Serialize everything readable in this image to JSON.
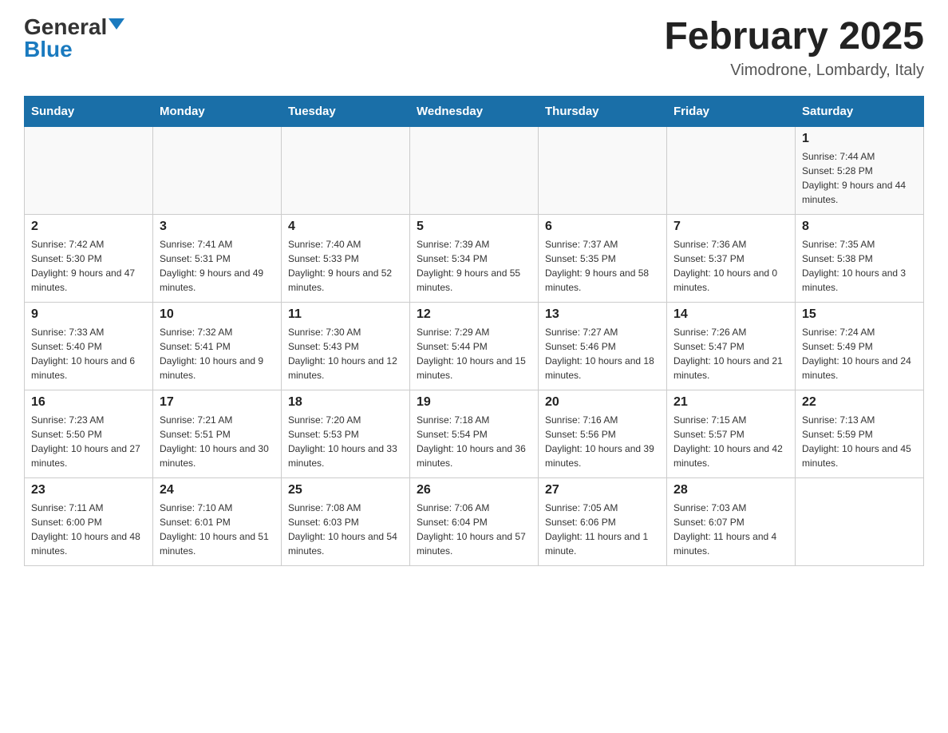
{
  "header": {
    "logo_general": "General",
    "logo_blue": "Blue",
    "title": "February 2025",
    "location": "Vimodrone, Lombardy, Italy"
  },
  "weekdays": [
    "Sunday",
    "Monday",
    "Tuesday",
    "Wednesday",
    "Thursday",
    "Friday",
    "Saturday"
  ],
  "rows": [
    [
      {
        "day": "",
        "sunrise": "",
        "sunset": "",
        "daylight": ""
      },
      {
        "day": "",
        "sunrise": "",
        "sunset": "",
        "daylight": ""
      },
      {
        "day": "",
        "sunrise": "",
        "sunset": "",
        "daylight": ""
      },
      {
        "day": "",
        "sunrise": "",
        "sunset": "",
        "daylight": ""
      },
      {
        "day": "",
        "sunrise": "",
        "sunset": "",
        "daylight": ""
      },
      {
        "day": "",
        "sunrise": "",
        "sunset": "",
        "daylight": ""
      },
      {
        "day": "1",
        "sunrise": "Sunrise: 7:44 AM",
        "sunset": "Sunset: 5:28 PM",
        "daylight": "Daylight: 9 hours and 44 minutes."
      }
    ],
    [
      {
        "day": "2",
        "sunrise": "Sunrise: 7:42 AM",
        "sunset": "Sunset: 5:30 PM",
        "daylight": "Daylight: 9 hours and 47 minutes."
      },
      {
        "day": "3",
        "sunrise": "Sunrise: 7:41 AM",
        "sunset": "Sunset: 5:31 PM",
        "daylight": "Daylight: 9 hours and 49 minutes."
      },
      {
        "day": "4",
        "sunrise": "Sunrise: 7:40 AM",
        "sunset": "Sunset: 5:33 PM",
        "daylight": "Daylight: 9 hours and 52 minutes."
      },
      {
        "day": "5",
        "sunrise": "Sunrise: 7:39 AM",
        "sunset": "Sunset: 5:34 PM",
        "daylight": "Daylight: 9 hours and 55 minutes."
      },
      {
        "day": "6",
        "sunrise": "Sunrise: 7:37 AM",
        "sunset": "Sunset: 5:35 PM",
        "daylight": "Daylight: 9 hours and 58 minutes."
      },
      {
        "day": "7",
        "sunrise": "Sunrise: 7:36 AM",
        "sunset": "Sunset: 5:37 PM",
        "daylight": "Daylight: 10 hours and 0 minutes."
      },
      {
        "day": "8",
        "sunrise": "Sunrise: 7:35 AM",
        "sunset": "Sunset: 5:38 PM",
        "daylight": "Daylight: 10 hours and 3 minutes."
      }
    ],
    [
      {
        "day": "9",
        "sunrise": "Sunrise: 7:33 AM",
        "sunset": "Sunset: 5:40 PM",
        "daylight": "Daylight: 10 hours and 6 minutes."
      },
      {
        "day": "10",
        "sunrise": "Sunrise: 7:32 AM",
        "sunset": "Sunset: 5:41 PM",
        "daylight": "Daylight: 10 hours and 9 minutes."
      },
      {
        "day": "11",
        "sunrise": "Sunrise: 7:30 AM",
        "sunset": "Sunset: 5:43 PM",
        "daylight": "Daylight: 10 hours and 12 minutes."
      },
      {
        "day": "12",
        "sunrise": "Sunrise: 7:29 AM",
        "sunset": "Sunset: 5:44 PM",
        "daylight": "Daylight: 10 hours and 15 minutes."
      },
      {
        "day": "13",
        "sunrise": "Sunrise: 7:27 AM",
        "sunset": "Sunset: 5:46 PM",
        "daylight": "Daylight: 10 hours and 18 minutes."
      },
      {
        "day": "14",
        "sunrise": "Sunrise: 7:26 AM",
        "sunset": "Sunset: 5:47 PM",
        "daylight": "Daylight: 10 hours and 21 minutes."
      },
      {
        "day": "15",
        "sunrise": "Sunrise: 7:24 AM",
        "sunset": "Sunset: 5:49 PM",
        "daylight": "Daylight: 10 hours and 24 minutes."
      }
    ],
    [
      {
        "day": "16",
        "sunrise": "Sunrise: 7:23 AM",
        "sunset": "Sunset: 5:50 PM",
        "daylight": "Daylight: 10 hours and 27 minutes."
      },
      {
        "day": "17",
        "sunrise": "Sunrise: 7:21 AM",
        "sunset": "Sunset: 5:51 PM",
        "daylight": "Daylight: 10 hours and 30 minutes."
      },
      {
        "day": "18",
        "sunrise": "Sunrise: 7:20 AM",
        "sunset": "Sunset: 5:53 PM",
        "daylight": "Daylight: 10 hours and 33 minutes."
      },
      {
        "day": "19",
        "sunrise": "Sunrise: 7:18 AM",
        "sunset": "Sunset: 5:54 PM",
        "daylight": "Daylight: 10 hours and 36 minutes."
      },
      {
        "day": "20",
        "sunrise": "Sunrise: 7:16 AM",
        "sunset": "Sunset: 5:56 PM",
        "daylight": "Daylight: 10 hours and 39 minutes."
      },
      {
        "day": "21",
        "sunrise": "Sunrise: 7:15 AM",
        "sunset": "Sunset: 5:57 PM",
        "daylight": "Daylight: 10 hours and 42 minutes."
      },
      {
        "day": "22",
        "sunrise": "Sunrise: 7:13 AM",
        "sunset": "Sunset: 5:59 PM",
        "daylight": "Daylight: 10 hours and 45 minutes."
      }
    ],
    [
      {
        "day": "23",
        "sunrise": "Sunrise: 7:11 AM",
        "sunset": "Sunset: 6:00 PM",
        "daylight": "Daylight: 10 hours and 48 minutes."
      },
      {
        "day": "24",
        "sunrise": "Sunrise: 7:10 AM",
        "sunset": "Sunset: 6:01 PM",
        "daylight": "Daylight: 10 hours and 51 minutes."
      },
      {
        "day": "25",
        "sunrise": "Sunrise: 7:08 AM",
        "sunset": "Sunset: 6:03 PM",
        "daylight": "Daylight: 10 hours and 54 minutes."
      },
      {
        "day": "26",
        "sunrise": "Sunrise: 7:06 AM",
        "sunset": "Sunset: 6:04 PM",
        "daylight": "Daylight: 10 hours and 57 minutes."
      },
      {
        "day": "27",
        "sunrise": "Sunrise: 7:05 AM",
        "sunset": "Sunset: 6:06 PM",
        "daylight": "Daylight: 11 hours and 1 minute."
      },
      {
        "day": "28",
        "sunrise": "Sunrise: 7:03 AM",
        "sunset": "Sunset: 6:07 PM",
        "daylight": "Daylight: 11 hours and 4 minutes."
      },
      {
        "day": "",
        "sunrise": "",
        "sunset": "",
        "daylight": ""
      }
    ]
  ]
}
